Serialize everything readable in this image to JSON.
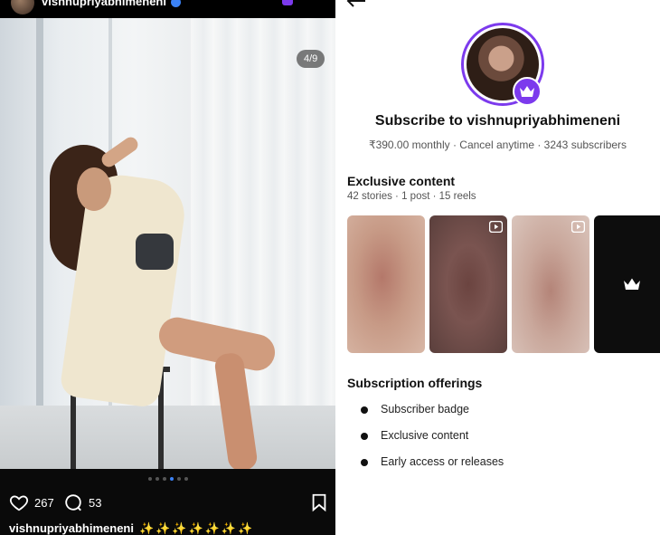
{
  "post": {
    "username": "vishnupriyabhimeneni",
    "carousel_counter": "4/9",
    "carousel_total": 9,
    "carousel_active_index": 4,
    "likes": "267",
    "comments": "53",
    "caption_user": "vishnupriyabhimeneni",
    "caption_text": "✨✨✨✨✨✨✨",
    "icons": [
      "heart-icon",
      "comment-icon",
      "bookmark-icon",
      "verified-badge-icon"
    ]
  },
  "subscribe": {
    "title": "Subscribe to vishnupriyabhimeneni",
    "meta": "₹390.00 monthly · Cancel anytime · 3243 subscribers",
    "exclusive_title": "Exclusive content",
    "exclusive_meta": "42 stories · 1 post · 15 reels",
    "offerings_title": "Subscription offerings",
    "offerings": [
      "Subscriber badge",
      "Exclusive content",
      "Early access or releases"
    ],
    "accent_color": "#7c3aed",
    "icons": [
      "back-arrow-icon",
      "crown-icon",
      "play-icon"
    ]
  }
}
